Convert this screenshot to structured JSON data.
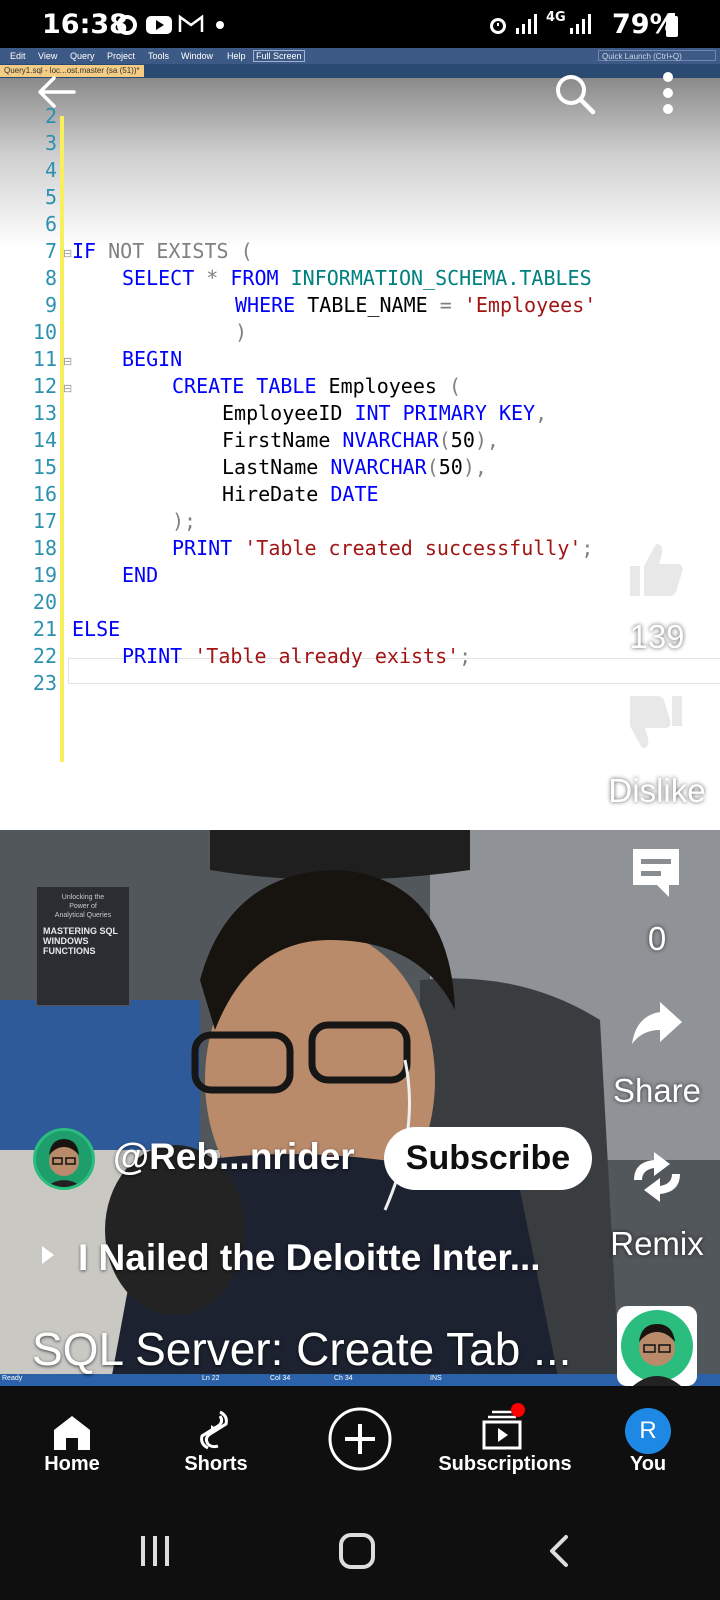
{
  "status_bar": {
    "time": "16:38",
    "battery": "79%",
    "network": "4G"
  },
  "ide": {
    "menu": [
      "Edit",
      "View",
      "Query",
      "Project",
      "Tools",
      "Window",
      "Help",
      "Full Screen"
    ],
    "document_tab": "Query1.sql - loc...ost.master (sa (51))*",
    "quick_launch": "Quick Launch (Ctrl+Q)",
    "line_numbers": [
      "2",
      "3",
      "4",
      "5",
      "6",
      "7",
      "8",
      "9",
      "10",
      "11",
      "12",
      "13",
      "14",
      "15",
      "16",
      "17",
      "18",
      "19",
      "20",
      "21",
      "22",
      "23"
    ],
    "status_items": [
      "Ready",
      "Ln 22",
      "Col 34",
      "Ch 34",
      "INS"
    ]
  },
  "code": {
    "l7": [
      "IF",
      "NOT",
      "EXISTS",
      "("
    ],
    "l8": [
      "SELECT",
      "*",
      "FROM",
      "INFORMATION_SCHEMA.TABLES"
    ],
    "l9": [
      "WHERE",
      "TABLE_NAME",
      "=",
      "'Employees'"
    ],
    "l10": [
      ")"
    ],
    "l11": [
      "BEGIN"
    ],
    "l12": [
      "CREATE TABLE",
      "Employees",
      "("
    ],
    "l13": [
      "EmployeeID",
      "INT PRIMARY KEY",
      ","
    ],
    "l14": [
      "FirstName",
      "NVARCHAR",
      "(",
      "50",
      "),"
    ],
    "l15": [
      "LastName",
      "NVARCHAR",
      "(",
      "50",
      "),"
    ],
    "l16": [
      "HireDate",
      "DATE"
    ],
    "l17": [
      ");"
    ],
    "l18": [
      "PRINT",
      "'Table created successfully'",
      ";"
    ],
    "l19": [
      "END"
    ],
    "l21": [
      "ELSE"
    ],
    "l22": [
      "PRINT",
      "'Table already exists'",
      ";"
    ]
  },
  "actions": {
    "like_count": "139",
    "dislike_label": "Dislike",
    "comment_count": "0",
    "share_label": "Share",
    "remix_label": "Remix"
  },
  "channel": {
    "handle": "@Reb...nrider",
    "subscribe_label": "Subscribe"
  },
  "related_video": "I Nailed the Deloitte Inter...",
  "video_title": "SQL Server: Create Tab ...",
  "book": {
    "line1": "Unlocking the",
    "line2": "Power of",
    "line3": "Analytical Queries",
    "title": "MASTERING SQL WINDOWS FUNCTIONS"
  },
  "bottom_nav": {
    "home": "Home",
    "shorts": "Shorts",
    "subscriptions": "Subscriptions",
    "you": "You",
    "you_initial": "R"
  },
  "colors": {
    "accent_red": "#ff0000",
    "you_avatar": "#1e88e5",
    "keyword_blue": "#0000ff",
    "string_red": "#a31515"
  }
}
